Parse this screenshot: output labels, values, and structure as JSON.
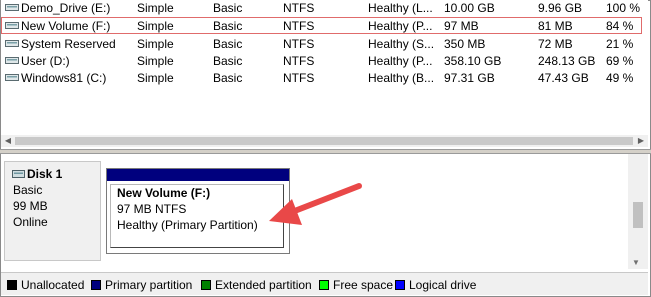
{
  "volumes": [
    {
      "name": "Demo_Drive (E:)",
      "layout": "Simple",
      "type": "Basic",
      "fs": "NTFS",
      "status": "Healthy (L...",
      "capacity": "10.00 GB",
      "free": "9.96 GB",
      "pct": "100 %"
    },
    {
      "name": "New Volume (F:)",
      "layout": "Simple",
      "type": "Basic",
      "fs": "NTFS",
      "status": "Healthy (P...",
      "capacity": "97 MB",
      "free": "81 MB",
      "pct": "84 %"
    },
    {
      "name": "System Reserved",
      "layout": "Simple",
      "type": "Basic",
      "fs": "NTFS",
      "status": "Healthy (S...",
      "capacity": "350 MB",
      "free": "72 MB",
      "pct": "21 %"
    },
    {
      "name": "User (D:)",
      "layout": "Simple",
      "type": "Basic",
      "fs": "NTFS",
      "status": "Healthy (P...",
      "capacity": "358.10 GB",
      "free": "248.13 GB",
      "pct": "69 %"
    },
    {
      "name": "Windows81 (C:)",
      "layout": "Simple",
      "type": "Basic",
      "fs": "NTFS",
      "status": "Healthy (B...",
      "capacity": "97.31 GB",
      "free": "47.43 GB",
      "pct": "49 %"
    }
  ],
  "disk": {
    "name": "Disk 1",
    "type": "Basic",
    "size": "99 MB",
    "state": "Online"
  },
  "partition": {
    "title": "New Volume  (F:)",
    "size_fs": "97 MB NTFS",
    "status": "Healthy (Primary Partition)"
  },
  "legend": [
    {
      "label": "Unallocated",
      "color": "#000000"
    },
    {
      "label": "Primary partition",
      "color": "#00007e"
    },
    {
      "label": "Extended partition",
      "color": "#008000"
    },
    {
      "label": "Free space",
      "color": "#00ff00"
    },
    {
      "label": "Logical drive",
      "color": "#0000ff"
    }
  ],
  "colors": {
    "primary_partition": "#00007e",
    "annotation_arrow": "#e94848",
    "selection_outline": "#e06b6b"
  },
  "icons": {
    "volume": "drive-icon",
    "disk": "disk-icon"
  }
}
